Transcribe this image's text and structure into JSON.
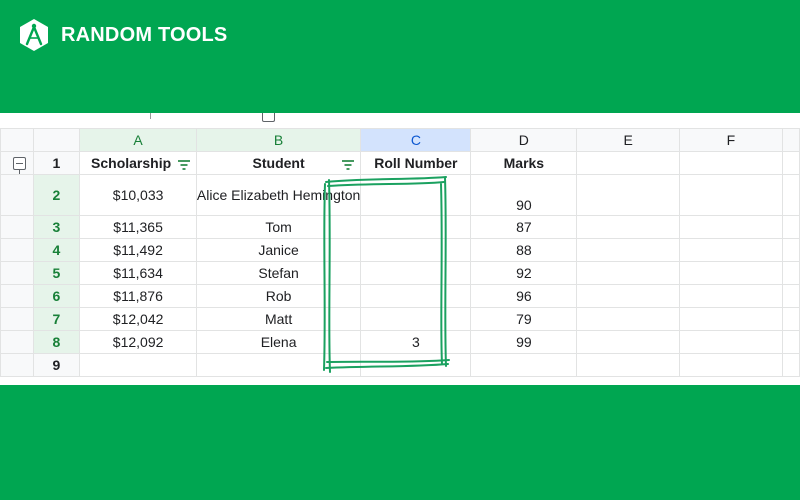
{
  "brand": {
    "name": "RANDOM TOOLS",
    "logo_icon": "compass-hexagon-icon"
  },
  "colors": {
    "brand_green": "#00a651",
    "highlight_green": "#0f9d58"
  },
  "sheet": {
    "columns": [
      "A",
      "B",
      "C",
      "D",
      "E",
      "F"
    ],
    "header_row": {
      "row_number": "1",
      "scholarship": "Scholarship",
      "student": "Student",
      "roll_number": "Roll Number",
      "marks": "Marks"
    },
    "rows": [
      {
        "row_number": "2",
        "scholarship": "$10,033",
        "student": "Alice Elizabeth Hemington",
        "roll_number": "",
        "marks": "90"
      },
      {
        "row_number": "3",
        "scholarship": "$11,365",
        "student": "Tom",
        "roll_number": "",
        "marks": "87"
      },
      {
        "row_number": "4",
        "scholarship": "$11,492",
        "student": "Janice",
        "roll_number": "",
        "marks": "88"
      },
      {
        "row_number": "5",
        "scholarship": "$11,634",
        "student": "Stefan",
        "roll_number": "",
        "marks": "92"
      },
      {
        "row_number": "6",
        "scholarship": "$11,876",
        "student": "Rob",
        "roll_number": "",
        "marks": "96"
      },
      {
        "row_number": "7",
        "scholarship": "$12,042",
        "student": "Matt",
        "roll_number": "",
        "marks": "79"
      },
      {
        "row_number": "8",
        "scholarship": "$12,092",
        "student": "Elena",
        "roll_number": "3",
        "marks": "99"
      }
    ],
    "empty_row": {
      "row_number": "9"
    }
  }
}
